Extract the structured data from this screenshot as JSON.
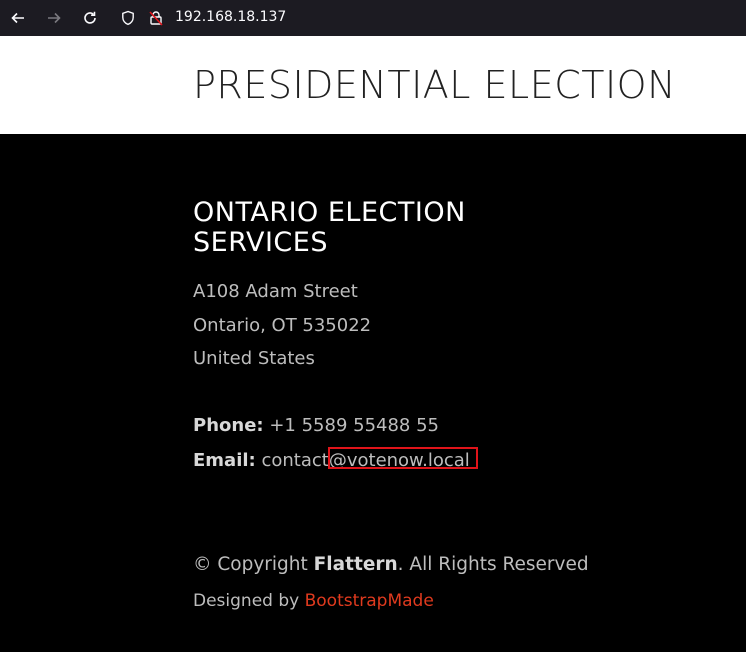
{
  "browser": {
    "url": "192.168.18.137",
    "icons": [
      "back-arrow-icon",
      "forward-arrow-icon",
      "reload-icon",
      "shield-icon",
      "insecure-lock-icon"
    ]
  },
  "header": {
    "title": "PRESIDENTIAL ELECTION"
  },
  "footer": {
    "org_name": "ONTARIO ELECTION SERVICES",
    "address": {
      "line1": "A108 Adam Street",
      "line2": "Ontario, OT 535022",
      "line3": "United States"
    },
    "phone_label": "Phone:",
    "phone_value": "+1 5589 55488 55",
    "email_label": "Email:",
    "email_value": "contact@votenow.local",
    "copyright_prefix": "© Copyright",
    "copyright_brand": "Flattern",
    "copyright_suffix": ". All Rights Reserved",
    "designed_by": "Designed by",
    "designer_link": "BootstrapMade"
  },
  "colors": {
    "header_bg": "#ffffff",
    "footer_bg": "#000000",
    "link_accent": "#e03a1e",
    "highlight": "#e0141a"
  }
}
